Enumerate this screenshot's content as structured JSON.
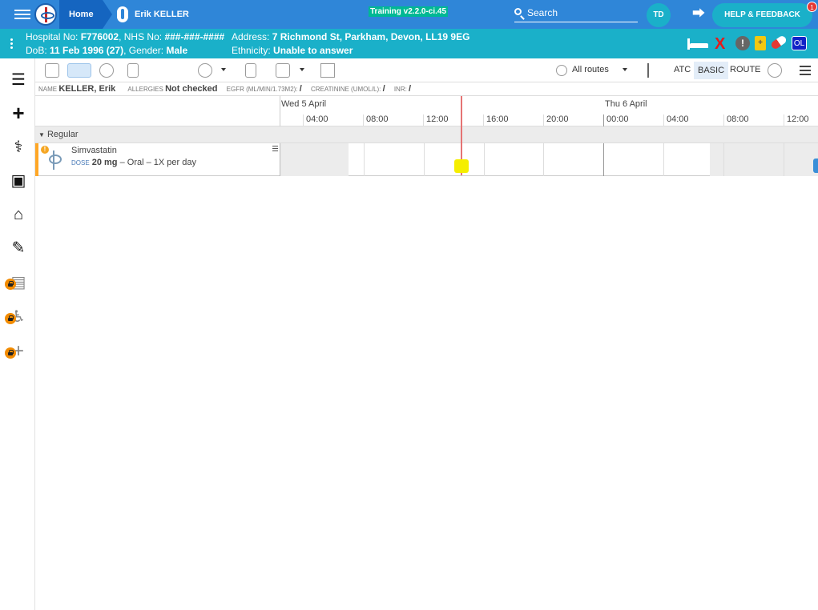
{
  "topbar": {
    "home_label": "Home",
    "patient_label": "Erik KELLER",
    "training_label": "Training v2.2.0-ci.45",
    "search_label": "Search",
    "avatar_initials": "TD",
    "help_label": "HELP & FEEDBACK",
    "help_badge": "1"
  },
  "banner": {
    "hospital_label": "Hospital No:",
    "hospital_no": "F776002",
    "nhs_label": "NHS No:",
    "nhs_no": "###-###-####",
    "address_label": "Address:",
    "address": "7 Richmond St, Parkham, Devon, LL19 9EG",
    "dob_label": "DoB:",
    "dob": "11 Feb 1996 (27)",
    "gender_label": "Gender:",
    "gender": "Male",
    "ethnicity_label": "Ethnicity:",
    "ethnicity": "Unable to answer",
    "icons": {
      "x": "X",
      "alert": "!",
      "clip": "+",
      "ol": "OL"
    },
    "accent_color": "#1ab0c9"
  },
  "toolbar": {
    "routes_label": "All routes",
    "atc_label": "ATC",
    "basic_label": "BASIC",
    "route_label": "ROUTE"
  },
  "infobar": {
    "name_label": "NAME",
    "name": "KELLER, Erik",
    "allergies_label": "ALLERGIES",
    "allergies": "Not checked",
    "egfr_label": "EGFR (ML/MIN/1.73M2):",
    "egfr": "/",
    "creat_label": "CREATININE (UMOL/L):",
    "creat": "/",
    "inr_label": "INR:",
    "inr": "/"
  },
  "timeline": {
    "day1": "Wed 5 April",
    "day2": "Thu 6 April",
    "ticks": [
      "04:00",
      "08:00",
      "12:00",
      "16:00",
      "20:00",
      "00:00",
      "04:00",
      "08:00",
      "12:00"
    ]
  },
  "group": {
    "label": "Regular"
  },
  "medication": {
    "name": "Simvastatin",
    "dose_label": "DOSE",
    "dose": "20 mg",
    "route_freq": "– Oral – 1X per day",
    "warn_glyph": "!"
  }
}
